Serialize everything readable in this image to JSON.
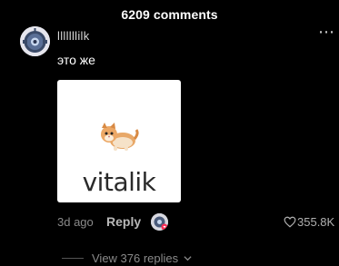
{
  "header": {
    "title": "6209 comments"
  },
  "comment": {
    "username": "lllllllilk",
    "text": "это же",
    "attachment_caption": "vitalik",
    "time": "3d ago",
    "reply_label": "Reply",
    "likes": "355.8K",
    "more_label": "⋯"
  },
  "replies": {
    "label": "View 376 replies"
  },
  "colors": {
    "background": "#000000",
    "text": "#ffffff",
    "muted": "#8a8a8a"
  }
}
